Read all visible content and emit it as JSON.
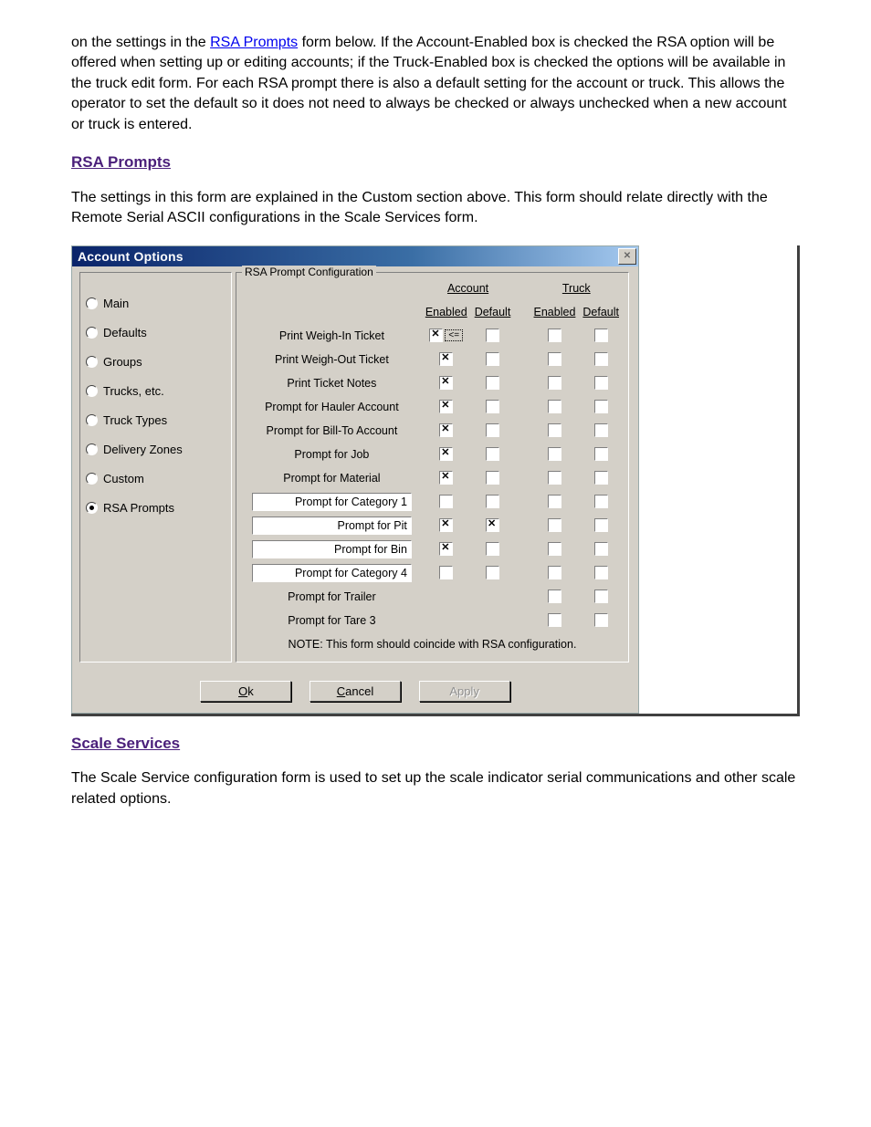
{
  "doc": {
    "para1_before": "on the settings in the ",
    "para1_link": "RSA Prompts",
    "para1_after": " form below. If the Account-Enabled box is checked the RSA option will be offered when setting up or editing accounts; if the Truck-Enabled box is checked the options will be available in the truck edit form. For each RSA prompt there is also a default setting for the account or truck. This allows the operator to set the default so it does not need to always be checked or always unchecked when a new account or truck is entered.",
    "heading1": "RSA Prompts",
    "intro": "The settings in this form are explained in the Custom section above. This form should relate directly with the Remote Serial ASCII configurations in the Scale Services form.",
    "heading2": "Scale Services",
    "scale_services_text": "The Scale Service configuration form is used to set up the scale indicator serial communications and other scale related options."
  },
  "dialog": {
    "title": "Account Options",
    "close_glyph": "✕",
    "sidebar": [
      {
        "label": "Main",
        "selected": false
      },
      {
        "label": "Defaults",
        "selected": false
      },
      {
        "label": "Groups",
        "selected": false
      },
      {
        "label": "Trucks, etc.",
        "selected": false
      },
      {
        "label": "Truck Types",
        "selected": false
      },
      {
        "label": "Delivery Zones",
        "selected": false
      },
      {
        "label": "Custom",
        "selected": false
      },
      {
        "label": "RSA Prompts",
        "selected": true
      }
    ],
    "group_legend": "RSA Prompt Configuration",
    "col_groups": [
      "Account",
      "Truck"
    ],
    "col_heads": [
      "Enabled",
      "Default",
      "Enabled",
      "Default"
    ],
    "rows": [
      {
        "label": "Print Weigh-In Ticket",
        "editable": false,
        "ae": true,
        "ad": false,
        "te": false,
        "td": false,
        "focus": true
      },
      {
        "label": "Print Weigh-Out Ticket",
        "editable": false,
        "ae": true,
        "ad": false,
        "te": false,
        "td": false
      },
      {
        "label": "Print Ticket Notes",
        "editable": false,
        "ae": true,
        "ad": false,
        "te": false,
        "td": false
      },
      {
        "label": "Prompt for Hauler Account",
        "editable": false,
        "ae": true,
        "ad": false,
        "te": false,
        "td": false
      },
      {
        "label": "Prompt for Bill-To Account",
        "editable": false,
        "ae": true,
        "ad": false,
        "te": false,
        "td": false
      },
      {
        "label": "Prompt for Job",
        "editable": false,
        "ae": true,
        "ad": false,
        "te": false,
        "td": false
      },
      {
        "label": "Prompt for Material",
        "editable": false,
        "ae": true,
        "ad": false,
        "te": false,
        "td": false
      },
      {
        "label": "Prompt for Category 1",
        "editable": true,
        "ae": false,
        "ad": false,
        "te": false,
        "td": false
      },
      {
        "label": "Prompt for Pit",
        "editable": true,
        "ae": true,
        "ad": true,
        "te": false,
        "td": false
      },
      {
        "label": "Prompt for Bin",
        "editable": true,
        "ae": true,
        "ad": false,
        "te": false,
        "td": false
      },
      {
        "label": "Prompt for Category 4",
        "editable": true,
        "ae": false,
        "ad": false,
        "te": false,
        "td": false
      },
      {
        "label": "Prompt for Trailer",
        "editable": false,
        "truckonly": true,
        "te": false,
        "td": false
      },
      {
        "label": "Prompt for Tare 3",
        "editable": false,
        "truckonly": true,
        "te": false,
        "td": false
      }
    ],
    "note": "NOTE:  This form should coincide with RSA configuration.",
    "focus_hint": "<=",
    "buttons": {
      "ok_pre": "O",
      "ok_u": "k",
      "cancel_u": "C",
      "cancel_post": "ancel",
      "apply": "Apply"
    }
  }
}
